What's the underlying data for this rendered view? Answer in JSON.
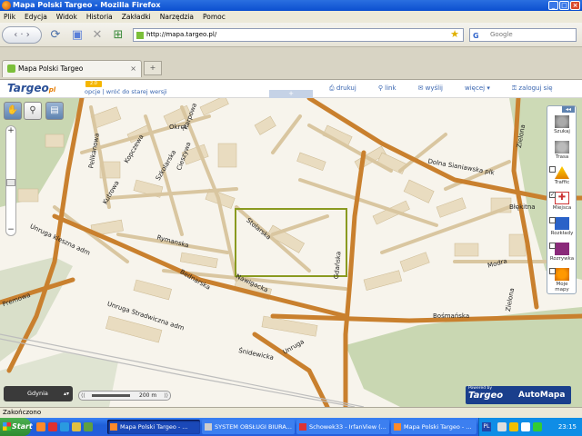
{
  "window": {
    "title": "Mapa Polski Targeo - Mozilla Firefox"
  },
  "menu": [
    "Plik",
    "Edycja",
    "Widok",
    "Historia",
    "Zakładki",
    "Narzędzia",
    "Pomoc"
  ],
  "nav": {
    "url": "http://mapa.targeo.pl/",
    "search_placeholder": "Google"
  },
  "tab": {
    "title": "Mapa Polski Targeo",
    "close": "×",
    "newtab": "+"
  },
  "site": {
    "logo_main": "Targeo",
    "logo_suffix": "pl",
    "version_badge": "2.0",
    "links_left": "opcje  |  wróć do starej wersji",
    "links_right": [
      "drukuj",
      "link",
      "wyślij",
      "więcej",
      "zaloguj się"
    ],
    "map_tab_symbol": "+"
  },
  "map": {
    "labels": [
      "Zielona",
      "Dolna Sianiawska plk",
      "Błękitna",
      "Modra",
      "Zielona",
      "Bośmańska",
      "Stolarska",
      "Gdańska",
      "Rymanska",
      "Bednarska",
      "Nawigacka",
      "Śnidewicka",
      "Unruga",
      "Pelikanowa",
      "Okręt",
      "Szkolarska",
      "Unruga kleszna adm",
      "Unruga Stradwiczna adm",
      "Premowa",
      "Kutrowa",
      "Cieszywa",
      "Karpowa",
      "Kopczewa"
    ],
    "city": "Gdynia",
    "scale": {
      "left": "⟨⟨",
      "value": "200",
      "unit": "m",
      "right": "⟩⟩"
    },
    "powered_by": "Powered by",
    "powered_brand": "Targeo",
    "powered_partner": "AutoMapa"
  },
  "right_panel": [
    {
      "label": "Szukaj",
      "icon": "search-icon"
    },
    {
      "label": "Trasa",
      "icon": "route-icon"
    },
    {
      "label": "Traffic",
      "icon": "traffic-icon"
    },
    {
      "label": "Miejsca",
      "icon": "places-icon"
    },
    {
      "label": "Rozkłady",
      "icon": "timetable-icon"
    },
    {
      "label": "Rozrywka",
      "icon": "entertainment-icon"
    },
    {
      "label": "Moje mapy",
      "icon": "my-maps-icon"
    }
  ],
  "status": "Zakończono",
  "taskbar": {
    "start": "Start",
    "items": [
      "Mapa Polski Targeo - ...",
      "SYSTEM OBSŁUGI BIURA...",
      "Schowek33 - IrfanView (...",
      "Mapa Polski Targeo - ..."
    ],
    "lang": "PL",
    "clock": "23:15"
  },
  "colors": {
    "road_major": "#c9802e",
    "road_minor": "#d9c6a0",
    "building": "#e9dcc0",
    "park": "#c9d7b2",
    "selection": "#8a9a20"
  }
}
